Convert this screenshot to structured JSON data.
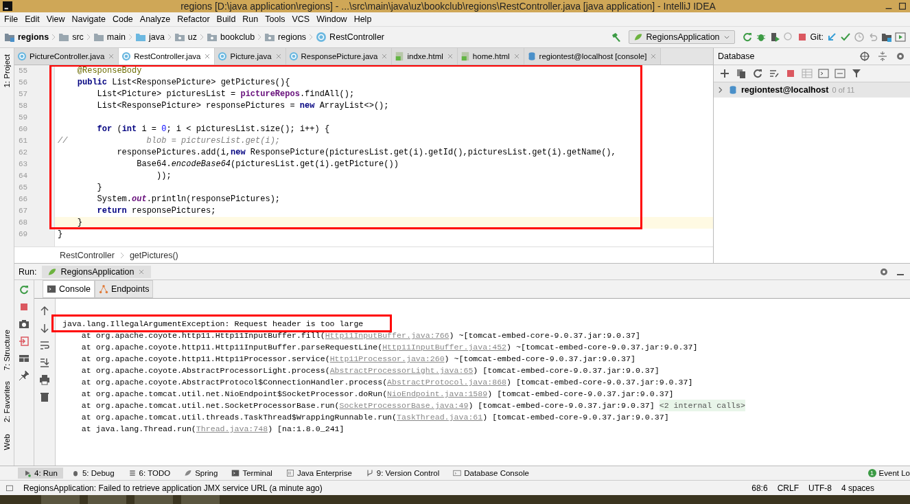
{
  "window": {
    "title": "regions [D:\\java application\\regions] - ...\\src\\main\\java\\uz\\bookclub\\regions\\RestController.java [java application] - IntelliJ IDEA"
  },
  "menu": [
    "File",
    "Edit",
    "View",
    "Navigate",
    "Code",
    "Analyze",
    "Refactor",
    "Build",
    "Run",
    "Tools",
    "VCS",
    "Window",
    "Help"
  ],
  "breadcrumbs": [
    {
      "label": "regions",
      "kind": "project"
    },
    {
      "label": "src",
      "kind": "folder"
    },
    {
      "label": "main",
      "kind": "folder"
    },
    {
      "label": "java",
      "kind": "source"
    },
    {
      "label": "uz",
      "kind": "package"
    },
    {
      "label": "bookclub",
      "kind": "package"
    },
    {
      "label": "regions",
      "kind": "package"
    },
    {
      "label": "RestController",
      "kind": "class"
    }
  ],
  "run_config": "RegionsApplication",
  "git_label": "Git:",
  "editor_tabs": [
    {
      "label": "PictureController.java",
      "kind": "java",
      "selected": false
    },
    {
      "label": "RestController.java",
      "kind": "java",
      "selected": true
    },
    {
      "label": "Picture.java",
      "kind": "java",
      "selected": false
    },
    {
      "label": "ResponsePicture.java",
      "kind": "java",
      "selected": false
    },
    {
      "label": "indxe.html",
      "kind": "html",
      "selected": false
    },
    {
      "label": "home.html",
      "kind": "html",
      "selected": false
    },
    {
      "label": "regiontest@localhost [console]",
      "kind": "db",
      "selected": false
    }
  ],
  "code": {
    "framed": true,
    "lines": [
      {
        "number": "55",
        "current": false,
        "tokens": [
          {
            "text": "    @ResponseBody",
            "kind": "annotation"
          }
        ]
      },
      {
        "number": "56",
        "current": false,
        "tokens": [
          {
            "text": "    public",
            "kind": "keyword"
          },
          {
            "text": " List<ResponsePicture> getPictures(){",
            "kind": "plain"
          }
        ]
      },
      {
        "number": "57",
        "current": false,
        "tokens": [
          {
            "text": "        List<Picture> picturesList = ",
            "kind": "plain"
          },
          {
            "text": "pictureRepos",
            "kind": "field"
          },
          {
            "text": ".findAll();",
            "kind": "plain"
          }
        ]
      },
      {
        "number": "58",
        "current": false,
        "tokens": [
          {
            "text": "        List<ResponsePicture> responsePictures = ",
            "kind": "plain"
          },
          {
            "text": "new",
            "kind": "keyword"
          },
          {
            "text": " ArrayList<>();",
            "kind": "plain"
          }
        ]
      },
      {
        "number": "59",
        "current": false
      },
      {
        "number": "60",
        "current": false,
        "tokens": [
          {
            "text": "        for",
            "kind": "keyword"
          },
          {
            "text": " (",
            "kind": "plain"
          },
          {
            "text": "int",
            "kind": "keyword"
          },
          {
            "text": " i = ",
            "kind": "plain"
          },
          {
            "text": "0",
            "kind": "number"
          },
          {
            "text": "; i < picturesList.size(); i++) {",
            "kind": "plain"
          }
        ]
      },
      {
        "number": "61",
        "current": false,
        "tokens": [
          {
            "text": "//                blob = picturesList.get(i);",
            "kind": "comment"
          }
        ]
      },
      {
        "number": "62",
        "current": false,
        "tokens": [
          {
            "text": "            responsePictures.add(i,",
            "kind": "plain"
          },
          {
            "text": "new",
            "kind": "keyword"
          },
          {
            "text": " ResponsePicture(picturesList.get(i).getId(),picturesList.get(i).getName(),",
            "kind": "plain"
          }
        ]
      },
      {
        "number": "63",
        "current": false,
        "tokens": [
          {
            "text": "                Base64.",
            "kind": "plain"
          },
          {
            "text": "encodeBase64",
            "kind": "static_method"
          },
          {
            "text": "(picturesList.get(i).getPicture())",
            "kind": "plain"
          }
        ]
      },
      {
        "number": "64",
        "current": false,
        "tokens": [
          {
            "text": "                    ));",
            "kind": "plain"
          }
        ]
      },
      {
        "number": "65",
        "current": false,
        "tokens": [
          {
            "text": "        }",
            "kind": "plain"
          }
        ]
      },
      {
        "number": "66",
        "current": false,
        "tokens": [
          {
            "text": "        System.",
            "kind": "plain"
          },
          {
            "text": "out",
            "kind": "static_field"
          },
          {
            "text": ".println(responsePictures);",
            "kind": "plain"
          }
        ]
      },
      {
        "number": "67",
        "current": false,
        "tokens": [
          {
            "text": "        return",
            "kind": "keyword"
          },
          {
            "text": " responsePictures;",
            "kind": "plain"
          }
        ]
      },
      {
        "number": "68",
        "current": true,
        "tokens": [
          {
            "text": "    }",
            "kind": "plain"
          }
        ]
      },
      {
        "number": "69",
        "current": false,
        "tokens": [
          {
            "text": "}",
            "kind": "plain"
          }
        ]
      }
    ]
  },
  "code_breadcrumbs": [
    "RestController",
    "getPictures()"
  ],
  "database": {
    "title": "Database",
    "items": [
      {
        "label": "regiontest@localhost",
        "count": "0 of 11",
        "selected": true
      }
    ]
  },
  "run": {
    "label": "Run:",
    "tab": "RegionsApplication",
    "tabs": [
      {
        "label": "Console",
        "selected": true
      },
      {
        "label": "Endpoints",
        "selected": false
      }
    ],
    "lines": [
      {
        "text": "java.lang.IllegalArgumentException: Request header is too large",
        "framed": true
      },
      {
        "text": "    at org.apache.coyote.http11.Http11InputBuffer.fill(",
        "link": "Http11InputBuffer.java:766",
        "tail": ") ~[tomcat-embed-core-9.0.37.jar:9.0.37]",
        "framed": false
      },
      {
        "text": "    at org.apache.coyote.http11.Http11InputBuffer.parseRequestLine(",
        "link": "Http11InputBuffer.java:452",
        "tail": ") ~[tomcat-embed-core-9.0.37.jar:9.0.37]",
        "framed": false
      },
      {
        "text": "    at org.apache.coyote.http11.Http11Processor.service(",
        "link": "Http11Processor.java:260",
        "tail": ") ~[tomcat-embed-core-9.0.37.jar:9.0.37]",
        "framed": false
      },
      {
        "text": "    at org.apache.coyote.AbstractProcessorLight.process(",
        "link": "AbstractProcessorLight.java:65",
        "tail": ") [tomcat-embed-core-9.0.37.jar:9.0.37]",
        "framed": false
      },
      {
        "text": "    at org.apache.coyote.AbstractProtocol$ConnectionHandler.process(",
        "link": "AbstractProtocol.java:868",
        "tail": ") [tomcat-embed-core-9.0.37.jar:9.0.37]",
        "framed": false
      },
      {
        "text": "    at org.apache.tomcat.util.net.NioEndpoint$SocketProcessor.doRun(",
        "link": "NioEndpoint.java:1589",
        "tail": ") [tomcat-embed-core-9.0.37.jar:9.0.37]",
        "framed": false
      },
      {
        "text": "    at org.apache.tomcat.util.net.SocketProcessorBase.run(",
        "link": "SocketProcessorBase.java:49",
        "tail": ") [tomcat-embed-core-9.0.37.jar:9.0.37]",
        "note": "<2 internal calls>",
        "framed": false
      },
      {
        "text": "    at org.apache.tomcat.util.threads.TaskThread$WrappingRunnable.run(",
        "link": "TaskThread.java:61",
        "tail": ") [tomcat-embed-core-9.0.37.jar:9.0.37]",
        "framed": false
      },
      {
        "text": "    at java.lang.Thread.run(",
        "link": "Thread.java:748",
        "tail": ") [na:1.8.0_241]",
        "framed": false
      }
    ]
  },
  "left_tools": {
    "top": [
      "1: Project"
    ],
    "bottom": [
      "7: Structure",
      "2: Favorites",
      "Web"
    ]
  },
  "bottom_tools": [
    {
      "label": "4: Run",
      "selected": true
    },
    {
      "label": "5: Debug",
      "selected": false
    },
    {
      "label": "6: TODO",
      "selected": false
    },
    {
      "label": "Spring",
      "selected": false
    },
    {
      "label": "Terminal",
      "selected": false
    },
    {
      "label": "Java Enterprise",
      "selected": false
    },
    {
      "label": "9: Version Control",
      "selected": false
    },
    {
      "label": "Database Console",
      "selected": false
    }
  ],
  "event_log": {
    "badge": "1",
    "label": "Event Lo"
  },
  "status": {
    "message": "RegionsApplication: Failed to retrieve application JMX service URL (a minute ago)",
    "items": [
      "68:6",
      "CRLF",
      "UTF-8",
      "4 spaces"
    ]
  }
}
